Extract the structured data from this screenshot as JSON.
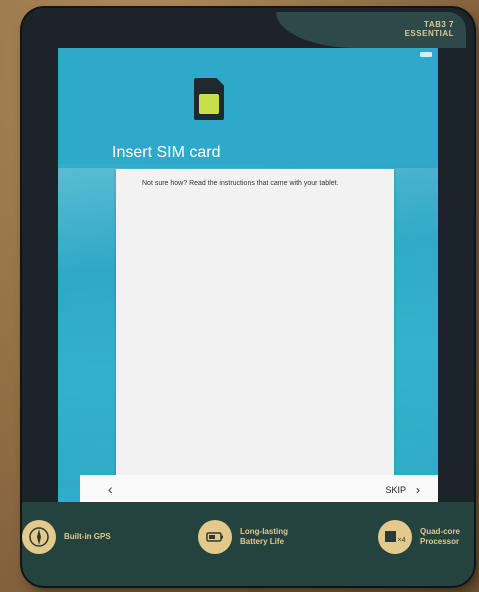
{
  "device": {
    "brand_line1": "TAB3 7",
    "brand_line2": "ESSENTIAL"
  },
  "features": [
    {
      "icon": "compass-icon",
      "label_line1": "Built-in GPS",
      "label_line2": ""
    },
    {
      "icon": "battery-icon",
      "label_line1": "Long-lasting",
      "label_line2": "Battery Life"
    },
    {
      "icon": "processor-icon",
      "label_line1": "Quad-core",
      "label_line2": "Processor"
    }
  ],
  "processor_badge": "×4",
  "screen": {
    "title": "Insert SIM card",
    "instructions": "Not sure how? Read the instructions that came with your tablet.",
    "back_label": "‹",
    "skip_label": "SKIP",
    "skip_icon": "chevron-right-icon"
  },
  "colors": {
    "screen_accent": "#2fa9c9",
    "sim_chip": "#c6e04a",
    "bezel_band": "#24433f",
    "feature_gold": "#e3c98b"
  }
}
